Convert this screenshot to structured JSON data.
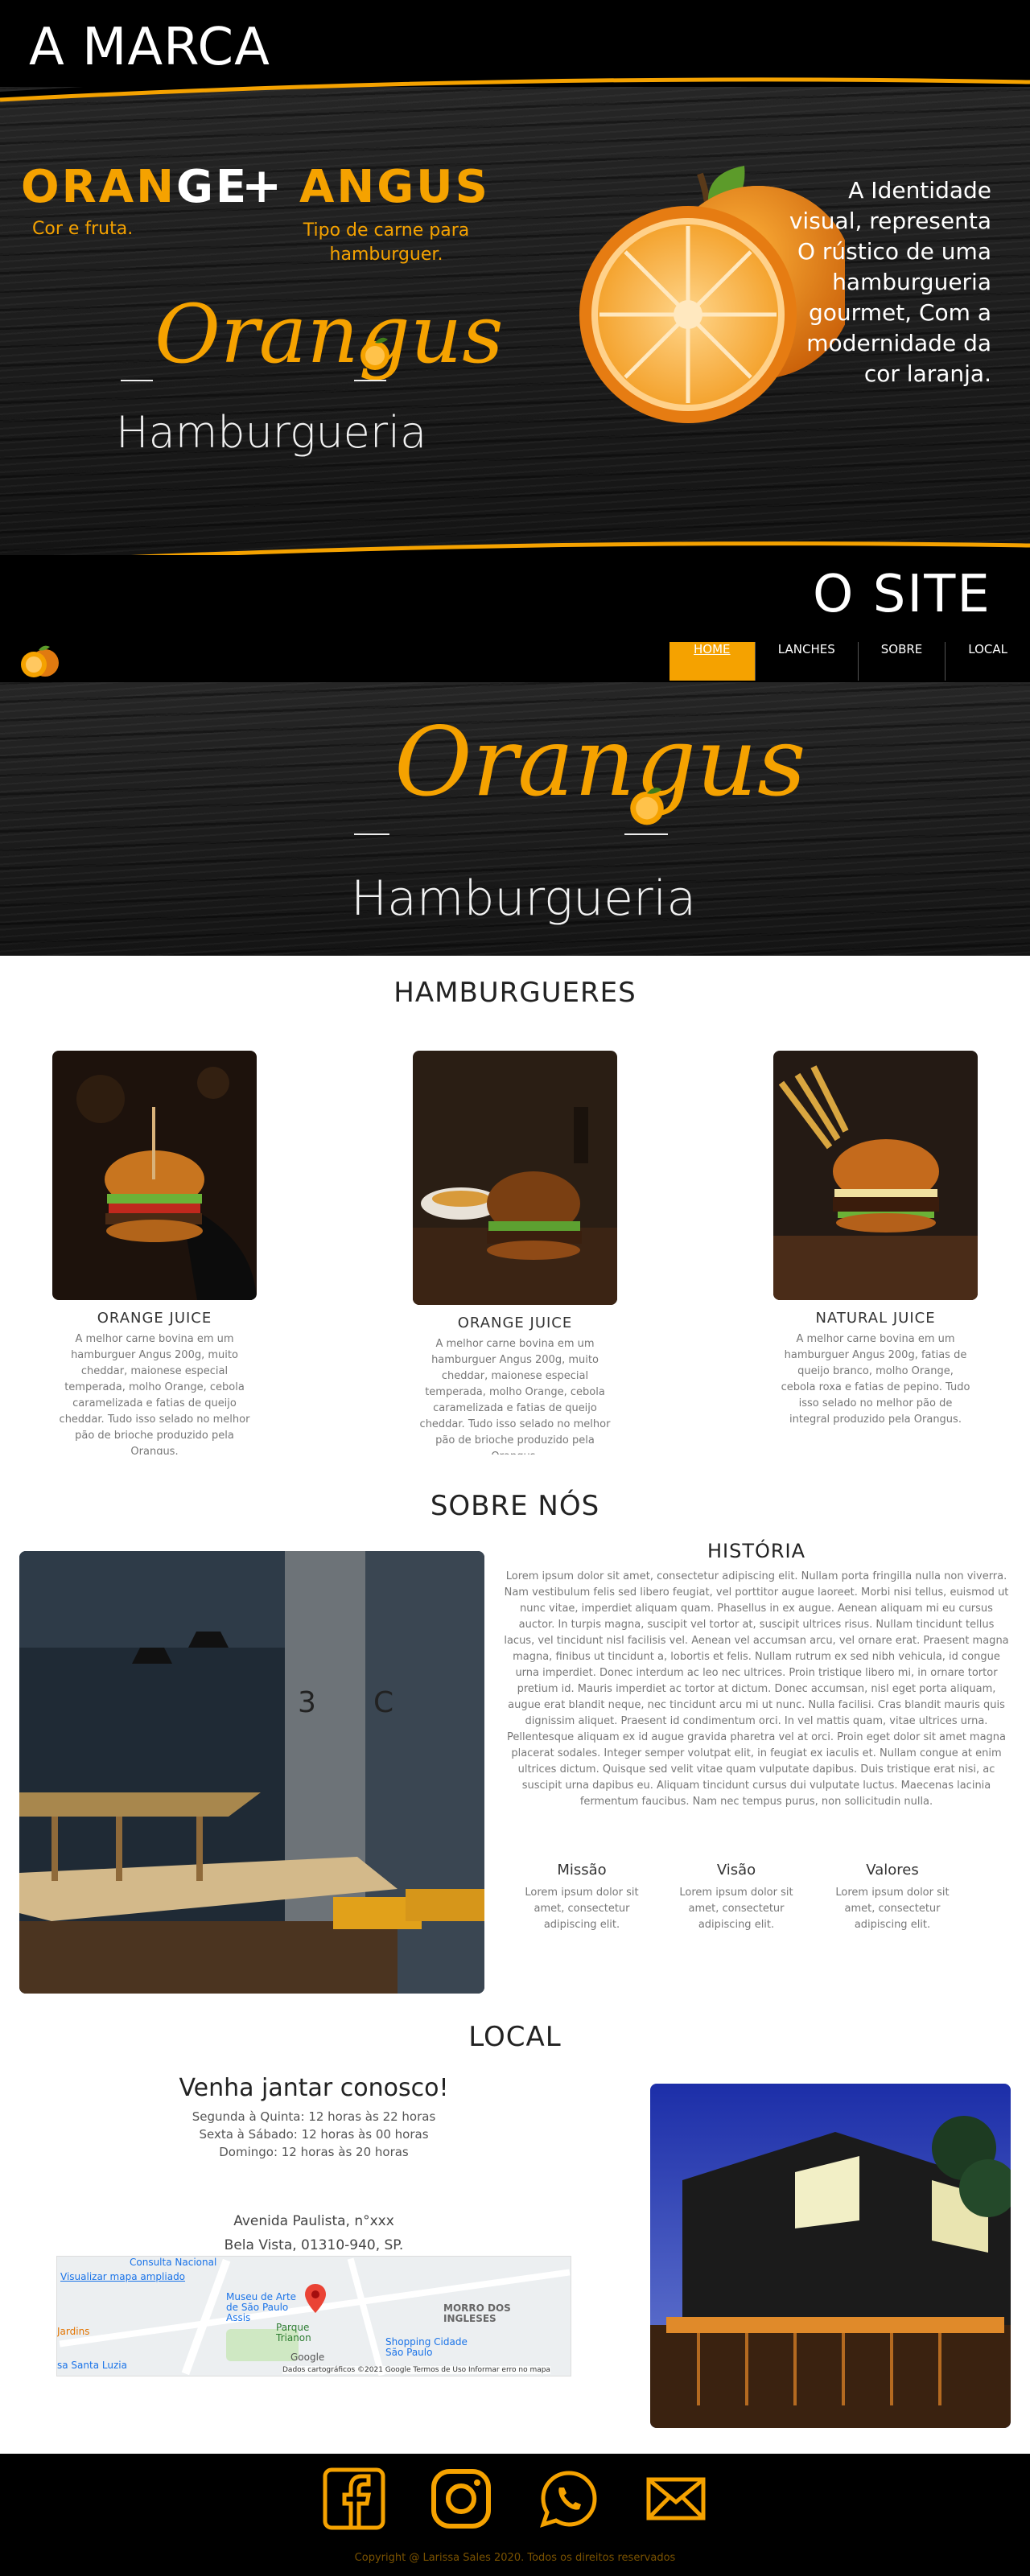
{
  "colors": {
    "accent": "#f5a200",
    "background": "#000000",
    "text_muted": "#777777"
  },
  "marca": {
    "heading": "A MARCA",
    "word_orange_a": "ORAN",
    "word_orange_b": "GE",
    "plus": "+",
    "word_angus": "ANGUS",
    "caption_orange": "Cor e fruta.",
    "caption_angus": "Tipo de carne para hamburguer.",
    "logo_script": "Orangus",
    "logo_sub": "Hamburgueria",
    "identity_text": "A Identidade visual, representa O rústico de uma hamburgueria gourmet, Com a modernidade da cor laranja."
  },
  "site": {
    "heading": "O SITE",
    "nav": [
      {
        "label": "HOME"
      },
      {
        "label": "LANCHES"
      },
      {
        "label": "SOBRE"
      },
      {
        "label": "LOCAL"
      }
    ],
    "hero_script": "Orangus",
    "hero_sub": "Hamburgueria"
  },
  "burgers": {
    "title": "HAMBURGUERES",
    "items": [
      {
        "name": "ORANGE JUICE",
        "desc": "A melhor carne bovina em um hamburguer Angus 200g, muito cheddar, maionese especial temperada, molho Orange, cebola caramelizada e fatias de queijo cheddar. Tudo isso selado no melhor pão de brioche produzido pela Orangus."
      },
      {
        "name": "ORANGE JUICE",
        "desc": "A melhor carne bovina em um hamburguer Angus 200g, muito cheddar, maionese especial temperada, molho Orange, cebola caramelizada e fatias de queijo cheddar. Tudo isso selado no melhor pão de brioche produzido pela Orangus."
      },
      {
        "name": "NATURAL JUICE",
        "desc": "A melhor carne bovina em um hamburguer Angus 200g, fatias de queijo branco, molho Orange, cebola roxa e fatias de pepino. Tudo isso selado no melhor pão de integral produzido pela Orangus."
      }
    ]
  },
  "sobre": {
    "title": "SOBRE NÓS",
    "history_title": "HISTÓRIA",
    "history_text": "Lorem ipsum dolor sit amet, consectetur adipiscing elit. Nullam porta fringilla nulla non viverra. Nam vestibulum felis sed libero feugiat, vel porttitor augue laoreet. Morbi nisi tellus, euismod ut nunc vitae, imperdiet aliquam quam. Phasellus in ex augue. Aenean aliquam mi eu cursus auctor. In turpis magna, suscipit vel tortor at, suscipit ultrices risus. Nullam tincidunt tellus lacus, vel tincidunt nisl facilisis vel. Aenean vel accumsan arcu, vel ornare erat. Praesent magna magna, finibus ut tincidunt a, lobortis et felis. Nullam rutrum ex sed nibh vehicula, id congue urna imperdiet. Donec interdum ac leo nec ultrices. Proin tristique libero mi, in ornare tortor pretium id. Mauris imperdiet ac tortor at dictum. Donec accumsan, nisl eget porta aliquam, augue erat blandit neque, nec tincidunt arcu mi ut nunc. Nulla facilisi. Cras blandit mauris quis dignissim aliquet. Praesent id condimentum orci. In vel mattis quam, vitae ultrices urna. Pellentesque aliquam ex id augue gravida pharetra vel at orci. Proin eget dolor sit amet magna placerat sodales. Integer semper volutpat elit, in feugiat ex iaculis et. Nullam congue at enim ultrices dictum. Quisque sed velit vitae quam vulputate dapibus. Duis tristique erat nisi, ac suscipit urna dapibus eu. Aliquam tincidunt cursus dui vulputate luctus. Maecenas lacinia fermentum faucibus. Nam nec tempus purus, non sollicitudin nulla.",
    "values": [
      {
        "title": "Missão",
        "text": "Lorem ipsum dolor sit amet, consectetur adipiscing elit."
      },
      {
        "title": "Visão",
        "text": "Lorem ipsum dolor sit amet, consectetur adipiscing elit."
      },
      {
        "title": "Valores",
        "text": "Lorem ipsum dolor sit amet, consectetur adipiscing elit."
      }
    ]
  },
  "local": {
    "title": "LOCAL",
    "invite": "Venha jantar conosco!",
    "hours": [
      "Segunda à Quinta: 12 horas às 22 horas",
      "Sexta à Sábado: 12 horas às 00 horas",
      "Domingo: 12 horas às 20 horas"
    ],
    "address": [
      "Avenida Paulista, n°xxx",
      "Bela Vista, 01310-940, SP."
    ],
    "map": {
      "enlarge_link": "Visualizar mapa ampliado",
      "labels": [
        "Consulta Nacional",
        "Museu de Arte de São Paulo Assis",
        "Parque Trianon",
        "MORRO DOS INGLESES",
        "Shopping Cidade São Paulo",
        "Jardins",
        "sa Santa Luzia",
        "Google"
      ],
      "footer": "Dados cartográficos ©2021 Google   Termos de Uso   Informar erro no mapa"
    }
  },
  "footer": {
    "icons": [
      "facebook-icon",
      "instagram-icon",
      "whatsapp-icon",
      "mail-icon"
    ],
    "copyright": "Copyright @ Larissa Sales 2020. Todos os direitos reservados"
  }
}
